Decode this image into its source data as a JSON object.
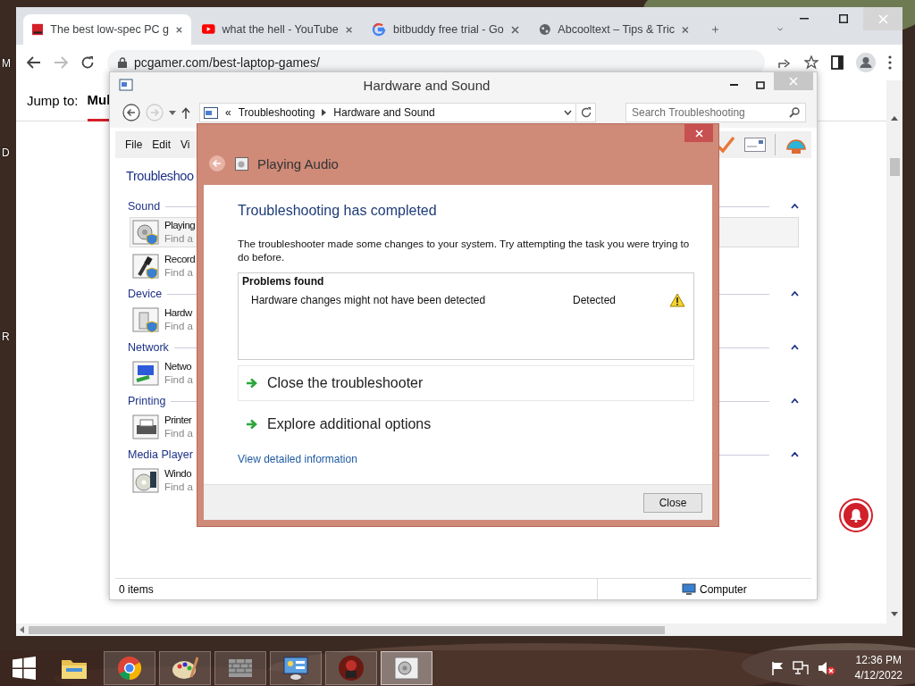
{
  "desktop": {
    "labels": [
      "M",
      "D",
      "R"
    ]
  },
  "browser": {
    "tabs": [
      {
        "kind": "pc",
        "title": "The best low-spec PC g",
        "selected": true
      },
      {
        "kind": "video",
        "title": "what the hell - YouTube",
        "selected": false
      },
      {
        "kind": "search",
        "title": "bitbuddy free trial - Go",
        "selected": false
      },
      {
        "kind": "globe",
        "title": "Abcooltext – Tips & Tric",
        "selected": false
      }
    ],
    "url": "pcgamer.com/best-laptop-games/",
    "page": {
      "jump_label": "Jump to:",
      "jump_items": [
        {
          "label": "Mul",
          "selected": true
        }
      ]
    }
  },
  "control_panel": {
    "title": "Hardware and Sound",
    "breadcrumb_prefix": "«",
    "breadcrumb": [
      "Troubleshooting",
      "Hardware and Sound"
    ],
    "search": {
      "placeholder": "Search Troubleshooting"
    },
    "menu": [
      "File",
      "Edit",
      "Vi"
    ],
    "heading": "Troubleshoo",
    "sections": [
      {
        "title": "Sound",
        "expanded": true,
        "items": [
          {
            "kind": "speaker",
            "name": "Playing",
            "description": "Find a",
            "selected": true
          },
          {
            "kind": "microphone",
            "name": "Record",
            "description": "Find a",
            "selected": false
          }
        ]
      },
      {
        "title": "Device",
        "expanded": true,
        "items": [
          {
            "kind": "device",
            "name": "Hardw",
            "description": "Find a",
            "selected": false
          }
        ]
      },
      {
        "title": "Network",
        "expanded": true,
        "items": [
          {
            "kind": "network",
            "name": "Netwo",
            "description": "Find a",
            "selected": false
          }
        ]
      },
      {
        "title": "Printing",
        "expanded": true,
        "items": [
          {
            "kind": "printer",
            "name": "Printer",
            "description": "Find a",
            "selected": false
          }
        ]
      },
      {
        "title": "Media Player",
        "expanded": true,
        "items": [
          {
            "kind": "media",
            "name": "Windo",
            "description": "Find a",
            "selected": false
          }
        ]
      }
    ],
    "status": {
      "count": "0 items",
      "location": "Computer"
    }
  },
  "dialog": {
    "title": "Playing Audio",
    "heading": "Troubleshooting has completed",
    "message": "The troubleshooter made some changes to your system. Try attempting the task you were trying to do before.",
    "problems": {
      "title": "Problems found",
      "rows": [
        {
          "problem": "Hardware changes might not have been detected",
          "status": "Detected",
          "kind": "warning"
        }
      ]
    },
    "commands": [
      {
        "label": "Close the troubleshooter",
        "selected": true
      },
      {
        "label": "Explore additional options",
        "selected": false
      }
    ],
    "link": "View detailed information",
    "button": "Close"
  },
  "taskbar": {
    "apps": [
      {
        "kind": "folder",
        "running": false,
        "selected": false
      },
      {
        "kind": "browser",
        "running": true,
        "selected": false
      },
      {
        "kind": "paint",
        "running": true,
        "selected": false
      },
      {
        "kind": "wall",
        "running": true,
        "selected": false
      },
      {
        "kind": "panel",
        "running": true,
        "selected": false
      },
      {
        "kind": "game",
        "running": true,
        "selected": false
      },
      {
        "kind": "troubleshooter",
        "running": true,
        "selected": true
      }
    ],
    "volume_muted": true,
    "time": "12:36 PM",
    "date": "4/12/2022"
  }
}
